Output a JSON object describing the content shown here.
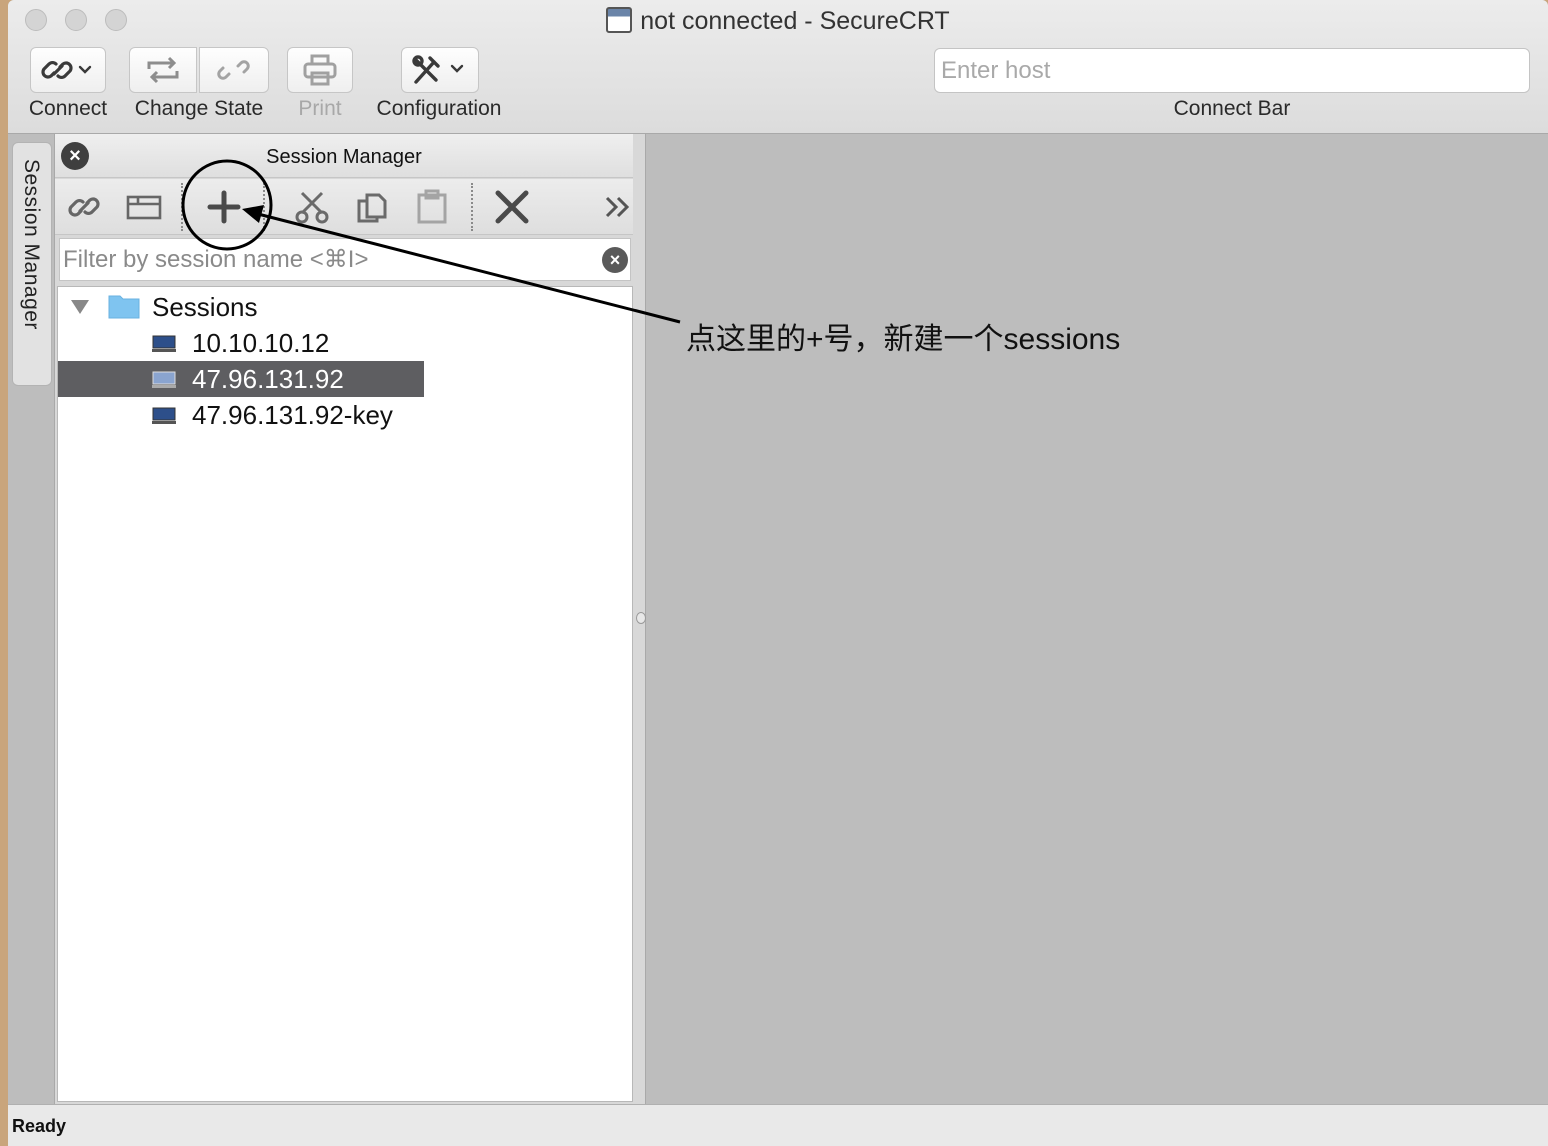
{
  "window": {
    "title": "not connected - SecureCRT"
  },
  "toolbar": {
    "connect_label": "Connect",
    "change_state_label": "Change State",
    "print_label": "Print",
    "configuration_label": "Configuration",
    "connect_bar_label": "Connect Bar",
    "host_placeholder": "Enter host"
  },
  "side_tab": {
    "label": "Session Manager"
  },
  "session_manager": {
    "title": "Session Manager",
    "filter_placeholder": "Filter by session name <⌘I>",
    "tree": {
      "root_label": "Sessions",
      "items": [
        {
          "label": "10.10.10.12",
          "selected": false
        },
        {
          "label": "47.96.131.92",
          "selected": true
        },
        {
          "label": "47.96.131.92-key",
          "selected": false
        }
      ]
    }
  },
  "annotation": {
    "text": "点这里的+号，新建一个sessions"
  },
  "status": {
    "text": "Ready"
  },
  "colors": {
    "selection": "#5e5e61",
    "folder": "#7fc4f0",
    "background": "#bdbdbd"
  }
}
